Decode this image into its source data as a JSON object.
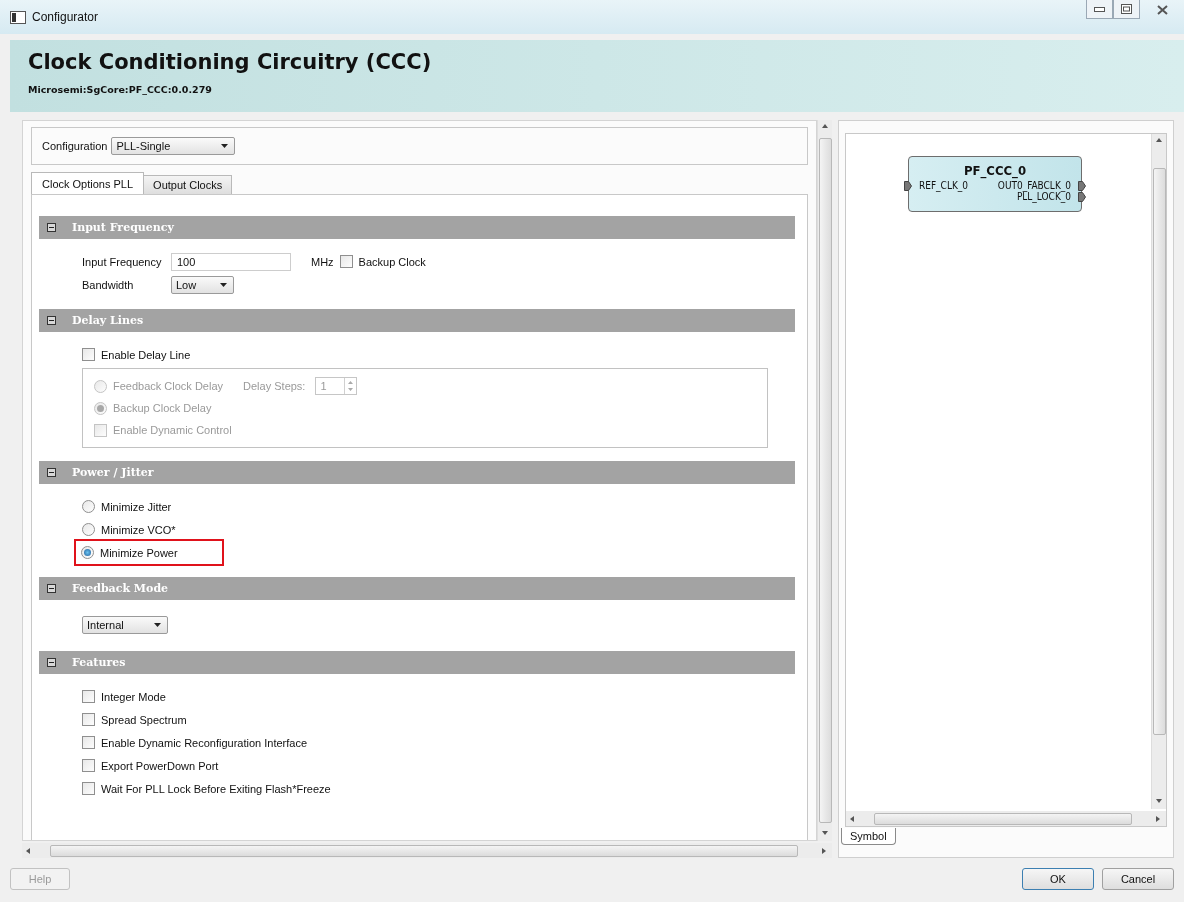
{
  "window": {
    "title": "Configurator"
  },
  "header": {
    "title": "Clock Conditioning Circuitry (CCC)",
    "subtitle": "Microsemi:SgCore:PF_CCC:0.0.279"
  },
  "configuration": {
    "label": "Configuration",
    "value": "PLL-Single"
  },
  "tabs": [
    {
      "label": "Clock Options PLL",
      "selected": true
    },
    {
      "label": "Output Clocks",
      "selected": false
    }
  ],
  "sections": [
    {
      "title": "Input Frequency",
      "expanded": true,
      "items": [
        {
          "kind": "field",
          "label": "Input Frequency",
          "value": "100",
          "unit": "MHz",
          "checkbox": {
            "label": "Backup Clock",
            "checked": false
          }
        },
        {
          "kind": "dropdown",
          "label": "Bandwidth",
          "value": "Low"
        }
      ]
    },
    {
      "title": "Delay Lines",
      "expanded": true,
      "items": [
        {
          "kind": "checkbox",
          "label": "Enable Delay Line",
          "checked": false,
          "disabled": false
        },
        {
          "kind": "group",
          "items": [
            {
              "kind": "radio",
              "label": "Feedback Clock Delay",
              "selected": false,
              "disabled": true,
              "highlighted": false,
              "steps": {
                "label": "Delay Steps:",
                "value": "1"
              }
            },
            {
              "kind": "radio",
              "label": "Backup Clock Delay",
              "selected": true,
              "disabled": true,
              "highlighted": false
            },
            {
              "kind": "checkbox",
              "label": "Enable Dynamic Control",
              "checked": false,
              "disabled": true
            }
          ]
        }
      ]
    },
    {
      "title": "Power / Jitter",
      "expanded": true,
      "items": [
        {
          "kind": "radio",
          "label": "Minimize Jitter",
          "selected": false,
          "disabled": false,
          "highlighted": false
        },
        {
          "kind": "radio",
          "label": "Minimize VCO*",
          "selected": false,
          "disabled": false,
          "highlighted": false
        },
        {
          "kind": "radio",
          "label": "Minimize Power",
          "selected": true,
          "disabled": false,
          "highlighted": true
        }
      ]
    },
    {
      "title": "Feedback Mode",
      "expanded": true,
      "items": [
        {
          "kind": "dropdown",
          "value": "Internal"
        }
      ]
    },
    {
      "title": "Features",
      "expanded": true,
      "items": [
        {
          "kind": "checkbox",
          "label": "Integer Mode",
          "checked": false,
          "disabled": false
        },
        {
          "kind": "checkbox",
          "label": "Spread Spectrum",
          "checked": false,
          "disabled": false
        },
        {
          "kind": "checkbox",
          "label": "Enable Dynamic Reconfiguration Interface",
          "checked": false,
          "disabled": false
        },
        {
          "kind": "checkbox",
          "label": "Export PowerDown Port",
          "checked": false,
          "disabled": false
        },
        {
          "kind": "checkbox",
          "label": "Wait For PLL Lock Before Exiting Flash*Freeze",
          "checked": false,
          "disabled": false
        }
      ]
    }
  ],
  "symbol_panel": {
    "block": {
      "name": "PF_CCC_0",
      "inputs": [
        "REF_CLK_0"
      ],
      "outputs": [
        "OUT0_FABCLK_0",
        "PLL_LOCK_0"
      ]
    },
    "tabs": [
      {
        "label": "Symbol",
        "selected": true
      }
    ]
  },
  "buttons": [
    {
      "label": "Help",
      "disabled": true
    },
    {
      "label": "OK",
      "disabled": false
    },
    {
      "label": "Cancel",
      "disabled": false
    }
  ]
}
